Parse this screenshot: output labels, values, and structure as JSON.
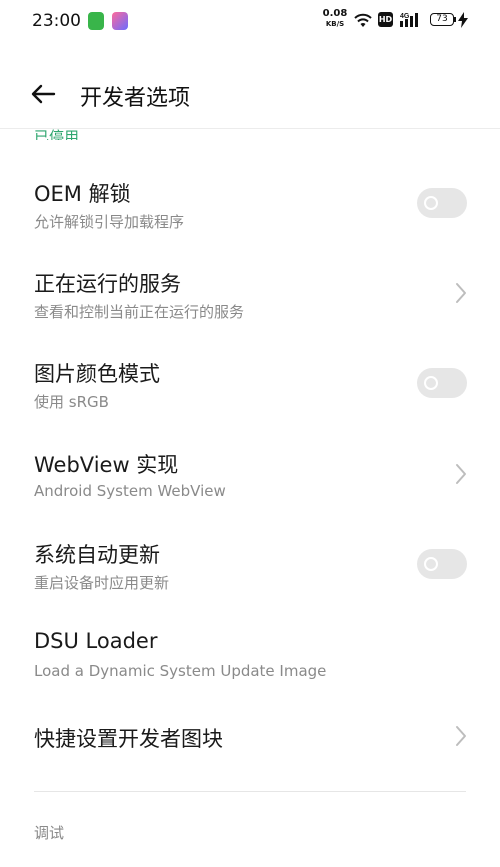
{
  "status_bar": {
    "time": "23:00",
    "net_speed_value": "0.08",
    "net_speed_unit": "KB/S",
    "hd_label": "HD",
    "battery_level": "73"
  },
  "app_bar": {
    "title": "开发者选项"
  },
  "clipped_text": "已停用",
  "settings": [
    {
      "title": "OEM 解锁",
      "subtitle": "允许解锁引导加载程序",
      "control": "toggle",
      "state": "off"
    },
    {
      "title": "正在运行的服务",
      "subtitle": "查看和控制当前正在运行的服务",
      "control": "chevron"
    },
    {
      "title": "图片颜色模式",
      "subtitle": "使用 sRGB",
      "control": "toggle",
      "state": "off"
    },
    {
      "title": "WebView 实现",
      "subtitle": "Android System WebView",
      "control": "chevron"
    },
    {
      "title": "系统自动更新",
      "subtitle": "重启设备时应用更新",
      "control": "toggle",
      "state": "off"
    },
    {
      "title": "DSU Loader",
      "subtitle": "Load a Dynamic System Update Image",
      "control": "none"
    },
    {
      "title": "快捷设置开发者图块",
      "control": "chevron"
    }
  ],
  "section_header": "调试"
}
